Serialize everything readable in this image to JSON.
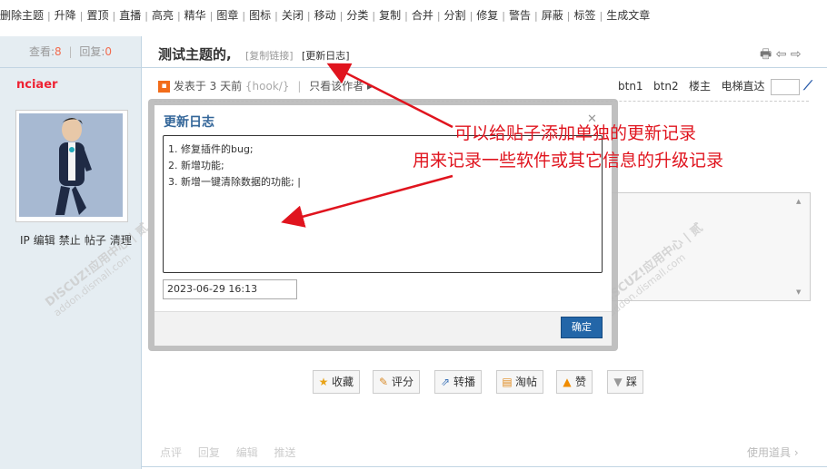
{
  "toolbar": {
    "items": [
      "删除主题",
      "升降",
      "置顶",
      "直播",
      "高亮",
      "精华",
      "图章",
      "图标",
      "关闭",
      "移动",
      "分类",
      "复制",
      "合并",
      "分割",
      "修复",
      "警告",
      "屏蔽",
      "标签",
      "生成文章"
    ],
    "separator": "|"
  },
  "sidebar": {
    "views_label": "查看:",
    "views": "8",
    "stat_sep": "|",
    "replies_label": "回复:",
    "replies": "0",
    "author": "nciaer",
    "admin_links": [
      "IP",
      "编辑",
      "禁止",
      "帖子",
      "清理"
    ]
  },
  "thread": {
    "title": "测试主题的,",
    "copy_link": "[复制链接]",
    "update_log_link": "[更新日志]",
    "header_icons": "🖶 ⇦ ⇨"
  },
  "post": {
    "posted": "发表于 3 天前",
    "hook": "{hook/}",
    "sep": "|",
    "author_only": "只看该作者 ▸",
    "btn1": "btn1",
    "btn2": "btn2",
    "floor_host": "楼主",
    "elevator": "电梯直达"
  },
  "dialog": {
    "title": "更新日志",
    "lines": [
      "1. 修复插件的bug;",
      "2. 新增功能;",
      "3. 新增一键清除数据的功能; |"
    ],
    "date": "2023-06-29 16:13",
    "ok_label": "确定"
  },
  "actions": [
    {
      "label": "收藏",
      "icon": "★",
      "color": "#e8a317"
    },
    {
      "label": "评分",
      "icon": "✎",
      "color": "#d98c2b"
    },
    {
      "label": "转播",
      "icon": "⇗",
      "color": "#3b73b9"
    },
    {
      "label": "淘帖",
      "icon": "▤",
      "color": "#e08a1e"
    },
    {
      "label": "赞",
      "icon": "▲",
      "color": "#f08c00"
    },
    {
      "label": "踩",
      "icon": "▼",
      "color": "#999999"
    }
  ],
  "bottom": {
    "items": [
      "点评",
      "回复",
      "编辑",
      "推送"
    ],
    "use_tool": "使用道具 ›"
  },
  "watermark": {
    "brand": "DISCUZ!应用中心 | 贰",
    "url": "addon.dismall.com"
  },
  "annotations": {
    "line1": "可以给贴子添加单独的更新记录",
    "line2": "用来记录一些软件或其它信息的升级记录",
    "color": "#e0141e"
  }
}
